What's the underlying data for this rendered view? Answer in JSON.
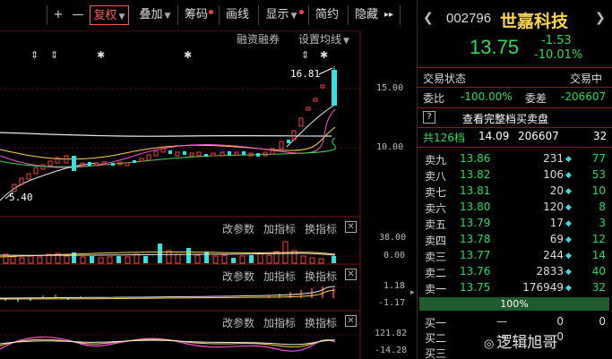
{
  "toolbar": {
    "plus_label": "+",
    "minus_label": "—",
    "fuquan_label": "复权",
    "diejia_label": "叠加",
    "chouma_label": "筹码",
    "huaxian_label": "画线",
    "xianshi_label": "显示",
    "jianyue_label": "简约",
    "yincang_label": "隐藏",
    "more_label": "▸▸"
  },
  "chart": {
    "rzrq_label": "融资融券",
    "ma_setting_label": "设置均线",
    "high_label": "16.81",
    "low_label": "5.40",
    "price_ticks": [
      "15.00",
      "10.00"
    ],
    "vol_ticks": [
      "38.00",
      "0.00"
    ],
    "macd_ticks": [
      "1.18",
      "-1.17"
    ],
    "kdj_ticks": [
      "121.82",
      "-14.28"
    ],
    "panel_links": {
      "gai_canshu": "改参数",
      "jia_zhibiao": "加指标",
      "huan_zhibiao": "换指标",
      "close": "✕"
    }
  },
  "quote": {
    "code": "002796",
    "name": "世嘉科技",
    "price": "13.75",
    "change": "-1.53",
    "change_pct": "-10.01%",
    "trade_state_label": "交易状态",
    "trade_state_value": "交易中",
    "weibi_label": "委比",
    "weibi_value": "-100.00%",
    "weicha_label": "委差",
    "weicha_value": "-206607",
    "help_label": "?",
    "full_book_label": "查看完整档买卖盘",
    "total_label": "共126档",
    "total_price": "14.09",
    "total_vol": "206607",
    "total_sub": "32",
    "sell_rows": [
      {
        "label": "卖九",
        "price": "13.86",
        "vol": "231",
        "sub": "77"
      },
      {
        "label": "卖八",
        "price": "13.82",
        "vol": "106",
        "sub": "53"
      },
      {
        "label": "卖七",
        "price": "13.81",
        "vol": "20",
        "sub": "10"
      },
      {
        "label": "卖六",
        "price": "13.80",
        "vol": "120",
        "sub": "8"
      },
      {
        "label": "卖五",
        "price": "13.79",
        "vol": "17",
        "sub": "3"
      },
      {
        "label": "卖四",
        "price": "13.78",
        "vol": "69",
        "sub": "12"
      },
      {
        "label": "卖三",
        "price": "13.77",
        "vol": "244",
        "sub": "14"
      },
      {
        "label": "卖二",
        "price": "13.76",
        "vol": "2833",
        "sub": "40"
      },
      {
        "label": "卖一",
        "price": "13.75",
        "vol": "176949",
        "sub": "32"
      }
    ],
    "pct_bar_label": "100%",
    "buy_rows": [
      {
        "label": "买一",
        "price": "—",
        "vol": "0",
        "sub": "0"
      },
      {
        "label": "买二",
        "price": "—",
        "vol": "0",
        "sub": ""
      },
      {
        "label": "买三",
        "price": "",
        "vol": "",
        "sub": ""
      }
    ]
  },
  "watermark": "逻辑旭哥",
  "colors": {
    "up": "#ff4040",
    "down": "#2bdc5b",
    "cyan": "#33e1e1",
    "price_yellow": "#ffd54a",
    "stock_name": "#ffd54a"
  }
}
